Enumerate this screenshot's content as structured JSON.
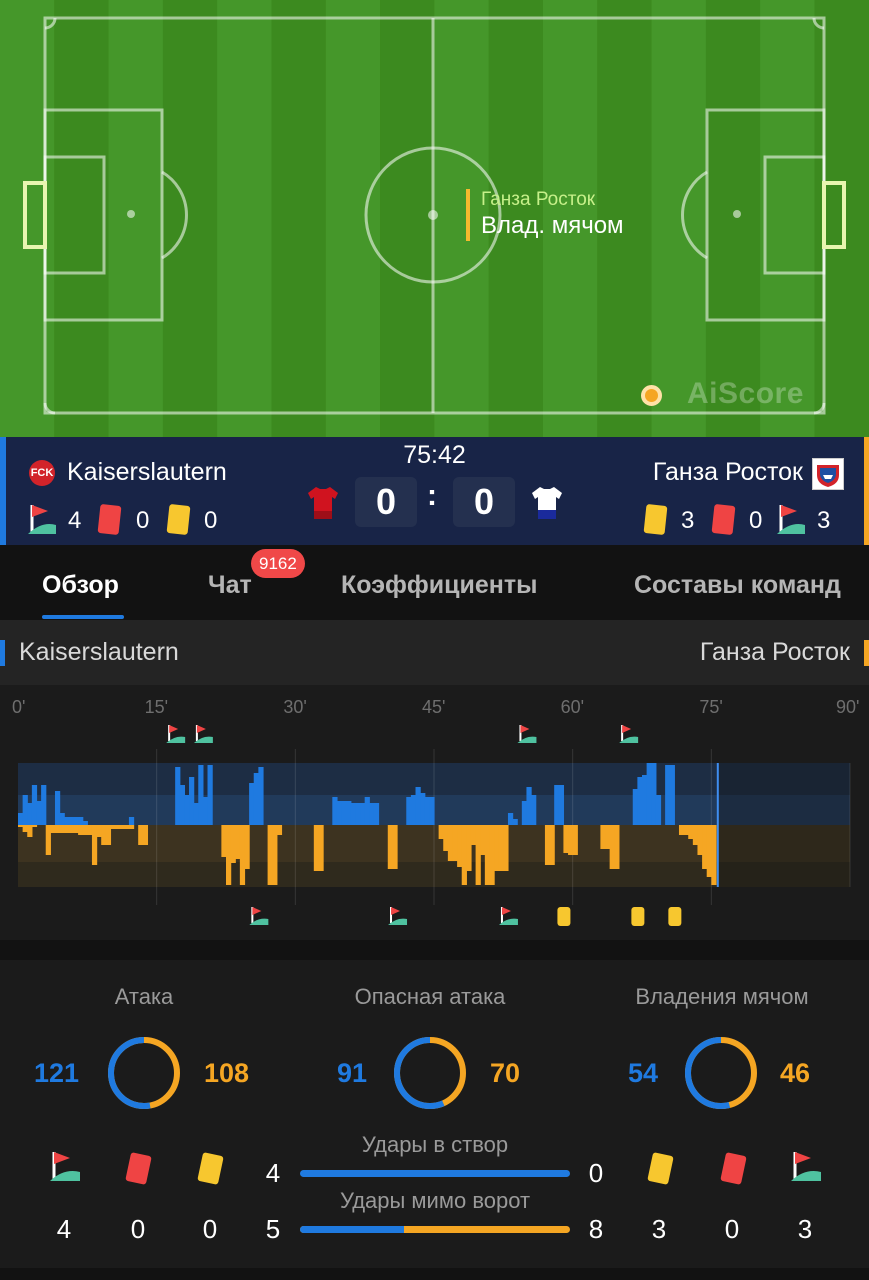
{
  "pitch": {
    "event_team": "Ганза Росток",
    "event_action": "Влад. мячом",
    "watermark": "AiScore"
  },
  "match": {
    "time": "75:42",
    "home": {
      "name": "Kaiserslautern",
      "logo_text": "FCK",
      "corners": "4",
      "red_cards": "0",
      "yellow_cards": "0",
      "score": "0",
      "kit_color": "#d0131f"
    },
    "away": {
      "name": "Ганза Росток",
      "corners": "3",
      "red_cards": "0",
      "yellow_cards": "3",
      "score": "0",
      "kit_color": "#ffffff"
    },
    "score_separator": ":"
  },
  "tabs": [
    {
      "label": "Обзор",
      "active": true
    },
    {
      "label": "Чат",
      "badge": "9162"
    },
    {
      "label": "Коэффициенты"
    },
    {
      "label": "Составы команд"
    }
  ],
  "overview": {
    "home_label": "Kaiserslautern",
    "away_label": "Ганза Росток"
  },
  "momentum": {
    "minute_ticks": [
      "0'",
      "15'",
      "30'",
      "45'",
      "60'",
      "75'",
      "90'"
    ],
    "current_minute": 75.7,
    "home_corner_minutes": [
      17,
      20,
      55,
      66
    ],
    "away_corner_minutes": [
      26,
      41,
      53
    ],
    "away_yellow_minutes": [
      59,
      67,
      71
    ],
    "home_pressure": [
      32,
      22,
      42,
      22,
      45,
      0,
      37,
      12,
      8,
      8,
      8,
      8,
      12,
      0,
      0,
      0,
      0,
      0,
      7,
      0,
      58,
      36,
      49,
      23,
      55,
      28,
      57,
      38,
      0,
      0,
      0,
      0,
      0,
      38,
      22,
      54,
      0,
      7,
      0,
      0,
      0,
      30,
      27,
      35,
      0,
      0,
      0,
      0,
      0,
      0,
      0,
      0,
      0,
      28,
      26,
      22,
      26,
      22,
      22,
      24,
      0,
      0,
      0,
      35,
      38,
      26,
      0,
      0,
      0,
      0,
      0,
      0,
      0,
      0,
      0,
      0,
      0,
      0,
      0,
      0,
      0,
      0,
      0,
      0,
      0,
      0,
      10,
      0,
      0,
      25,
      38,
      43,
      10,
      0,
      0,
      0,
      0,
      0,
      0,
      0,
      0,
      0,
      0,
      0,
      0,
      0,
      0,
      0,
      0,
      0,
      40,
      42,
      50,
      50,
      35,
      62,
      28,
      23,
      0,
      0,
      0,
      0,
      0,
      0,
      0,
      0,
      0,
      0,
      0,
      0,
      0,
      0,
      0,
      0,
      0,
      0
    ],
    "away_pressure": [
      0,
      0,
      0,
      0,
      0,
      0,
      0,
      0,
      0,
      0,
      0,
      0,
      0,
      0,
      0,
      0,
      0,
      0,
      0,
      0,
      0,
      0,
      0,
      0,
      0,
      0,
      0,
      0,
      0,
      0,
      0,
      0,
      0,
      0,
      0,
      0,
      0,
      0,
      0,
      0,
      0,
      0,
      0,
      0,
      0,
      0,
      0,
      0,
      0,
      0,
      0,
      0,
      0,
      0,
      0,
      0,
      0,
      0,
      0,
      0,
      0,
      0,
      0,
      0,
      0,
      0,
      0,
      0,
      0,
      0,
      0,
      0,
      0,
      0,
      0,
      0,
      0,
      0,
      0,
      0,
      0,
      0,
      0,
      0,
      0,
      0,
      0,
      0,
      0,
      0,
      0,
      0,
      0,
      0,
      0,
      0,
      0,
      0,
      0,
      0,
      0,
      0,
      0,
      0,
      0,
      0,
      0,
      0,
      0,
      0,
      0,
      0,
      0,
      0,
      0,
      0,
      0,
      0,
      0,
      0,
      0,
      0,
      0,
      0,
      0,
      0,
      0,
      0,
      0,
      0,
      0,
      0,
      0,
      0,
      0,
      0,
      0,
      0,
      0,
      0,
      0,
      0
    ],
    "home_bars": [
      [
        0,
        15
      ],
      [
        1,
        33
      ],
      [
        2,
        28
      ],
      [
        3,
        18
      ],
      [
        4,
        33
      ],
      [
        5,
        0
      ],
      [
        6,
        38
      ],
      [
        7,
        0
      ],
      [
        8,
        0
      ],
      [
        9,
        0
      ],
      [
        10,
        0
      ],
      [
        11,
        0
      ],
      [
        12,
        0
      ],
      [
        13,
        0
      ],
      [
        14,
        0
      ],
      [
        15,
        0
      ]
    ],
    "bars": [
      [
        0.0,
        12,
        2
      ],
      [
        0.5,
        30,
        7
      ],
      [
        1.0,
        22,
        12
      ],
      [
        1.5,
        40,
        2
      ],
      [
        2.0,
        24,
        0
      ],
      [
        2.5,
        40,
        0
      ],
      [
        3.0,
        0,
        30
      ],
      [
        3.5,
        0,
        8
      ],
      [
        4.0,
        34,
        8
      ],
      [
        4.5,
        12,
        8
      ],
      [
        5.0,
        8,
        8
      ],
      [
        5.5,
        8,
        8
      ],
      [
        6.0,
        8,
        8
      ],
      [
        6.5,
        8,
        10
      ],
      [
        7.0,
        4,
        10
      ],
      [
        7.5,
        0,
        10
      ],
      [
        8.0,
        0,
        40
      ],
      [
        8.5,
        0,
        12
      ],
      [
        9.0,
        0,
        20
      ],
      [
        9.5,
        0,
        20
      ],
      [
        10.0,
        0,
        4
      ],
      [
        10.5,
        0,
        4
      ],
      [
        11.0,
        0,
        4
      ],
      [
        11.5,
        0,
        4
      ],
      [
        12.0,
        8,
        4
      ],
      [
        12.5,
        0,
        0
      ],
      [
        13.0,
        0,
        20
      ],
      [
        13.5,
        0,
        20
      ],
      [
        14.0,
        0,
        0
      ],
      [
        14.5,
        0,
        0
      ],
      [
        15.0,
        0,
        0
      ],
      [
        15.5,
        0,
        0
      ],
      [
        16.0,
        0,
        0
      ],
      [
        16.5,
        0,
        0
      ],
      [
        17.0,
        58,
        0
      ],
      [
        17.5,
        40,
        0
      ],
      [
        18.0,
        30,
        0
      ],
      [
        18.5,
        48,
        0
      ],
      [
        19.0,
        22,
        0
      ],
      [
        19.5,
        60,
        0
      ],
      [
        20.0,
        28,
        0
      ],
      [
        20.5,
        60,
        0
      ],
      [
        21.0,
        0,
        0
      ],
      [
        21.5,
        0,
        0
      ],
      [
        22.0,
        0,
        32
      ],
      [
        22.5,
        0,
        60
      ],
      [
        23.0,
        0,
        38
      ],
      [
        23.5,
        0,
        34
      ],
      [
        24.0,
        0,
        60
      ],
      [
        24.5,
        0,
        44
      ],
      [
        25.0,
        42,
        0
      ],
      [
        25.5,
        52,
        0
      ],
      [
        26.0,
        58,
        0
      ],
      [
        26.5,
        0,
        0
      ],
      [
        27.0,
        0,
        60
      ],
      [
        27.5,
        0,
        60
      ],
      [
        28.0,
        0,
        10
      ],
      [
        28.5,
        0,
        0
      ],
      [
        29.0,
        0,
        0
      ],
      [
        29.5,
        0,
        0
      ],
      [
        30.0,
        0,
        0
      ],
      [
        30.5,
        0,
        0
      ],
      [
        31.0,
        0,
        0
      ],
      [
        31.5,
        0,
        0
      ],
      [
        32.0,
        0,
        46
      ],
      [
        32.5,
        0,
        46
      ],
      [
        33.0,
        0,
        0
      ],
      [
        33.5,
        0,
        0
      ],
      [
        34.0,
        28,
        0
      ],
      [
        34.5,
        24,
        0
      ],
      [
        35.0,
        24,
        0
      ],
      [
        35.5,
        24,
        0
      ],
      [
        36.0,
        22,
        0
      ],
      [
        36.5,
        22,
        0
      ],
      [
        37.0,
        22,
        0
      ],
      [
        37.5,
        28,
        0
      ],
      [
        38.0,
        22,
        0
      ],
      [
        38.5,
        22,
        0
      ],
      [
        39.0,
        0,
        0
      ],
      [
        39.5,
        0,
        0
      ],
      [
        40.0,
        0,
        44
      ],
      [
        40.5,
        0,
        44
      ],
      [
        41.0,
        0,
        0
      ],
      [
        41.5,
        0,
        0
      ],
      [
        42.0,
        28,
        0
      ],
      [
        42.5,
        30,
        0
      ],
      [
        43.0,
        38,
        0
      ],
      [
        43.5,
        32,
        0
      ],
      [
        44.0,
        28,
        0
      ],
      [
        44.5,
        28,
        0
      ],
      [
        45.0,
        0,
        0
      ],
      [
        45.5,
        0,
        14
      ],
      [
        46.0,
        0,
        26
      ],
      [
        46.5,
        0,
        36
      ],
      [
        47.0,
        0,
        36
      ],
      [
        47.5,
        0,
        42
      ],
      [
        48.0,
        0,
        60
      ],
      [
        48.5,
        0,
        46
      ],
      [
        49.0,
        0,
        20
      ],
      [
        49.5,
        0,
        60
      ],
      [
        50.0,
        0,
        30
      ],
      [
        50.5,
        0,
        60
      ],
      [
        51.0,
        0,
        60
      ],
      [
        51.5,
        0,
        46
      ],
      [
        52.0,
        0,
        46
      ],
      [
        52.5,
        0,
        46
      ],
      [
        53.0,
        12,
        0
      ],
      [
        53.5,
        6,
        0
      ],
      [
        54.0,
        0,
        0
      ],
      [
        54.5,
        24,
        0
      ],
      [
        55.0,
        38,
        0
      ],
      [
        55.5,
        30,
        0
      ],
      [
        56.0,
        0,
        0
      ],
      [
        56.5,
        0,
        0
      ],
      [
        57.0,
        0,
        40
      ],
      [
        57.5,
        0,
        40
      ],
      [
        58.0,
        40,
        0
      ],
      [
        58.5,
        40,
        0
      ],
      [
        59.0,
        0,
        28
      ],
      [
        59.5,
        0,
        30
      ],
      [
        60.0,
        0,
        30
      ],
      [
        60.5,
        0,
        0
      ],
      [
        61.0,
        0,
        0
      ],
      [
        61.5,
        0,
        0
      ],
      [
        62.0,
        0,
        0
      ],
      [
        62.5,
        0,
        0
      ],
      [
        63.0,
        0,
        24
      ],
      [
        63.5,
        0,
        24
      ],
      [
        64.0,
        0,
        44
      ],
      [
        64.5,
        0,
        44
      ],
      [
        65.0,
        0,
        0
      ],
      [
        65.5,
        0,
        0
      ],
      [
        66.0,
        0,
        0
      ],
      [
        66.5,
        36,
        0
      ],
      [
        67.0,
        48,
        0
      ],
      [
        67.5,
        50,
        0
      ],
      [
        68.0,
        62,
        0
      ],
      [
        68.5,
        62,
        0
      ],
      [
        69.0,
        30,
        0
      ],
      [
        69.5,
        0,
        0
      ],
      [
        70.0,
        60,
        0
      ],
      [
        70.5,
        60,
        0
      ],
      [
        71.0,
        0,
        0
      ],
      [
        71.5,
        0,
        10
      ],
      [
        72.0,
        0,
        10
      ],
      [
        72.5,
        0,
        14
      ],
      [
        73.0,
        0,
        20
      ],
      [
        73.5,
        0,
        30
      ],
      [
        74.0,
        0,
        44
      ],
      [
        74.5,
        0,
        52
      ],
      [
        75.0,
        0,
        60
      ]
    ]
  },
  "stats": {
    "attack": {
      "title": "Атака",
      "home": 121,
      "away": 108
    },
    "dangerous_attack": {
      "title": "Опасная атака",
      "home": 91,
      "away": 70
    },
    "possession": {
      "title": "Владения мячом",
      "home": 54,
      "away": 46
    },
    "shots_on_target": {
      "title": "Удары в створ",
      "home": 4,
      "away": 0
    },
    "shots_off_target": {
      "title": "Удары мимо ворот",
      "home": 5,
      "away": 8
    },
    "home_counts": {
      "corners": "4",
      "red_cards": "0",
      "yellow_cards": "0"
    },
    "away_counts": {
      "yellow_cards": "3",
      "red_cards": "0",
      "corners": "3"
    }
  },
  "colors": {
    "home": "#1f7ae0",
    "away": "#f5a623",
    "pitch": "#3f8f22",
    "red_card": "#ef4444",
    "yellow_card": "#f7c72f"
  },
  "icons": [
    "corner-flag-icon",
    "red-card-icon",
    "yellow-card-icon",
    "home-kit-icon",
    "away-kit-icon",
    "club-crest-icon"
  ]
}
